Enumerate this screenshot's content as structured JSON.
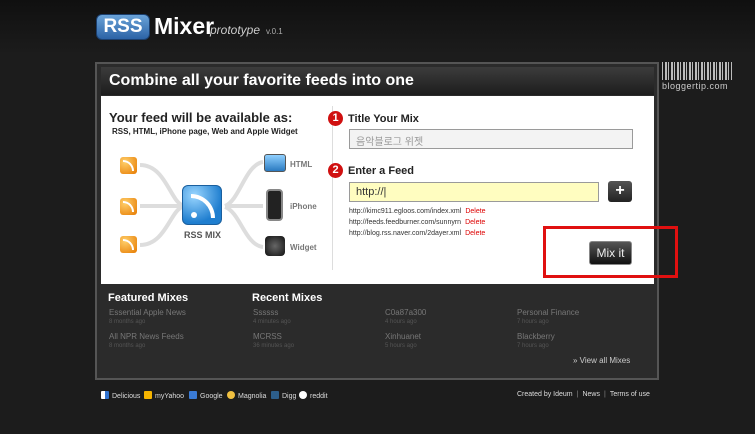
{
  "header": {
    "logo_rss": "RSS",
    "logo_mixer": "Mixer",
    "logo_prototype": "prototype",
    "logo_version": "v.0.1"
  },
  "watermark": "bloggertip.com",
  "panel": {
    "headline": "Combine all your favorite feeds into one",
    "left_title": "Your feed will be available as:",
    "left_subtitle": "RSS, HTML, iPhone page, Web and Apple Widget",
    "center_label": "RSS MIX",
    "outputs": [
      "HTML",
      "iPhone",
      "Widget"
    ]
  },
  "form": {
    "step1_number": "1",
    "step1_label": "Title Your Mix",
    "title_value": "음악블로그 위젯",
    "step2_number": "2",
    "step2_label": "Enter a Feed",
    "feed_value": "http://|",
    "add_label": "+",
    "feeds": [
      {
        "url": "http://kimc911.egloos.com/index.xml",
        "action": "Delete"
      },
      {
        "url": "http://feeds.feedburner.com/sunnyrn",
        "action": "Delete"
      },
      {
        "url": "http://blog.rss.naver.com/2dayer.xml",
        "action": "Delete"
      }
    ],
    "submit_label": "Mix it"
  },
  "featured": {
    "heading": "Featured Mixes",
    "items": [
      {
        "name": "Essential Apple News",
        "time": "8 months ago"
      },
      {
        "name": "All NPR News Feeds",
        "time": "8 months ago"
      }
    ]
  },
  "recent": {
    "heading": "Recent Mixes",
    "items": [
      {
        "name": "Ssssss",
        "time": "4 minutes ago"
      },
      {
        "name": "C0a87a300",
        "time": "4 hours ago"
      },
      {
        "name": "Personal Finance",
        "time": "7 hours ago"
      },
      {
        "name": "MCRSS",
        "time": "36 minutes ago"
      },
      {
        "name": "Xinhuanet",
        "time": "5 hours ago"
      },
      {
        "name": "Blackberry",
        "time": "7 hours ago"
      }
    ],
    "view_all": "» View all Mixes"
  },
  "footer": {
    "bookmarks": [
      "Delicious",
      "myYahoo",
      "Google",
      "Magnolia",
      "Digg",
      "reddit"
    ],
    "links": [
      "Created by Ideum",
      "News",
      "Terms of use"
    ]
  },
  "colors": {
    "accent_red": "#d01010",
    "logo_blue": "#2c63a6",
    "feed_input_bg": "#fffdc0"
  }
}
